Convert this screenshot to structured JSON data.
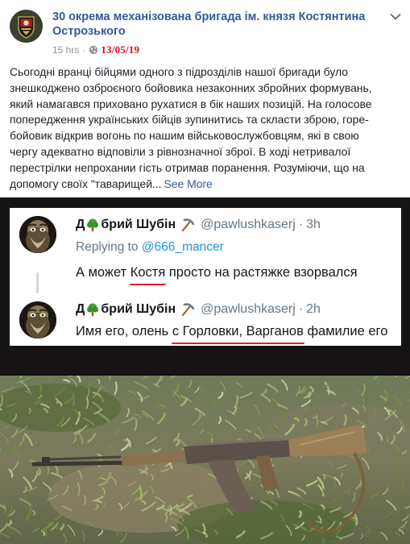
{
  "post": {
    "page_name": "30 окрема механізована бригада ім. князя Костянтина Острозького",
    "time": "15 hrs",
    "date_annotation": "13/05/19",
    "icons": {
      "page_logo": "brigade-emblem-icon",
      "privacy": "globe-icon",
      "options": "chevron-down-icon"
    },
    "text_lines": [
      "Сьогодні вранці бійцями одного з підрозділів нашої бригади було",
      "знешкоджено озброєного бойовика незаконних збройних формувань,",
      "який намагався приховано рухатися в бік наших позицій. На голосове",
      "попередження українських бійців зупинитись та скласти зброю, горе-",
      "бойовик відкрив вогонь по нашим військовослужбовцям, які в свою",
      "чергу адекватно відповіли з рівнозначної зброї. В ході нетривалої",
      "перестрілки непрохании гість отримав поранення. Розуміючи, що на"
    ],
    "last_line": "допомогу своїх \"таварищей...",
    "see_more": "See More"
  },
  "screenshot": {
    "tweets": [
      {
        "name_prefix": "Д",
        "name_suffix": "брий Шубін",
        "name_icons": [
          "tree-icon",
          "pickaxe-icon"
        ],
        "handle": "@pawlushkaserj",
        "dot": "·",
        "time": "3h",
        "replying_to_label": "Replying to",
        "replying_to_handle": "@666_mancer",
        "text_before": "А может ",
        "text_underlined": "Костя",
        "text_after": " просто на растяжке взорвался"
      },
      {
        "name_prefix": "Д",
        "name_suffix": "брий Шубін",
        "name_icons": [
          "tree-icon",
          "pickaxe-icon"
        ],
        "handle": "@pawlushkaserj",
        "dot": "·",
        "time": "2h",
        "text_before": "Имя его, олень ",
        "text_underlined": "с Горловки, Варганов",
        "text_after": " фамилие его"
      }
    ],
    "colors": {
      "link": "#365899",
      "date_annotation": "#dd1111",
      "underline_mark": "#e0212b",
      "twitter_blue": "#1b95e0",
      "muted": "#657786"
    }
  }
}
